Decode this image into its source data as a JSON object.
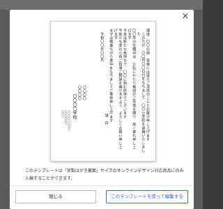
{
  "modal": {
    "close_symbol": "×",
    "preview": {
      "body_lines": [
        "謹啓　〇〇の候　皆様には益々ご清祥のこととお慶び申し上げます",
        "このたび　〇〇月〇〇日付をもちまして　〇〇小学校を退職いたしました",
        "〇〇年の在職中は　公私にわたり格別のご厚情を賜り　厚く御礼申し上げます",
        "今後は新たな気持ちで　〇〇に励む所存でございます",
        "今後とも変わらぬご指導ご鞭撻を賜りますよう　よろしくお願い申し上げます",
        "まずは略儀ながら書中をもちましてご挨拶申し上げます"
      ],
      "closing": "謹　白",
      "date_line": "令和〇〇年〇〇月",
      "sender_names": [
        "〇〇〇〇",
        "〇〇〇〇"
      ],
      "school_line": "〇〇〇〇学校",
      "address_lines": [
        "〒〇〇〇-〇〇〇〇",
        "〇〇〇〇〇〇",
        "〇〇〇"
      ]
    },
    "note_text": "このテンプレートは「官製はがき裏面」サイズのオンラインデザイン対応商品にのみ入稿することができます。",
    "buttons": {
      "close_label": "閉じる",
      "edit_label": "このテンプレートを使って編集する"
    },
    "colors": {
      "primary": "#2f61c9"
    }
  }
}
